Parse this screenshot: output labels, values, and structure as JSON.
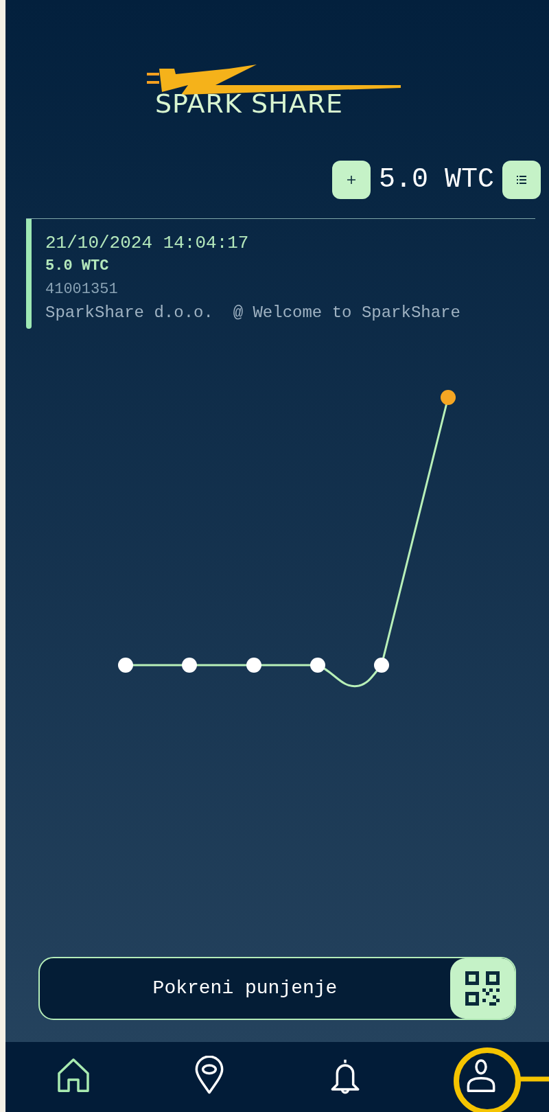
{
  "logo": {
    "text": "SPARK SHARE"
  },
  "balance": {
    "amount": "5.0 WTC"
  },
  "transaction": {
    "datetime": "21/10/2024 14:04:17",
    "amount": "5.0 WTC",
    "code": "41001351",
    "description": "SparkShare d.o.o.  @ Welcome to SparkShare"
  },
  "start_button": {
    "label": "Pokreni punjenje"
  },
  "nav": [
    {
      "kind": "home",
      "selected": true
    },
    {
      "kind": "location",
      "selected": false
    },
    {
      "kind": "notifications",
      "selected": false
    },
    {
      "kind": "profile",
      "selected": false
    }
  ]
}
